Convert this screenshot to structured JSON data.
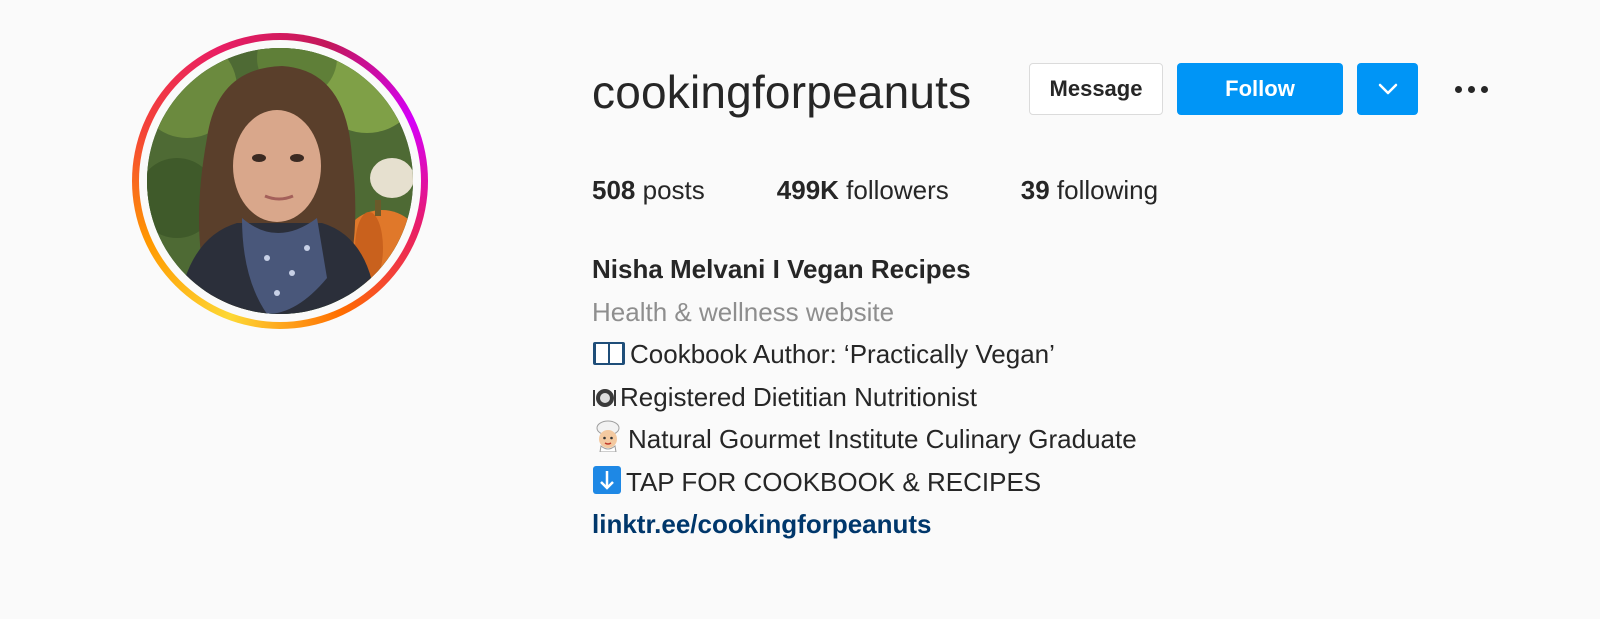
{
  "profile": {
    "username": "cookingforpeanuts",
    "avatar_alt": "profile picture"
  },
  "actions": {
    "message_label": "Message",
    "follow_label": "Follow",
    "dropdown_icon": "chevron-down-icon",
    "more_icon": "more-options-icon"
  },
  "stats": {
    "posts_count": "508",
    "posts_label": "posts",
    "followers_count": "499K",
    "followers_label": "followers",
    "following_count": "39",
    "following_label": "following"
  },
  "bio": {
    "name": "Nisha Melvani I Vegan Recipes",
    "category": "Health & wellness website",
    "lines": [
      {
        "icon": "open-book-icon",
        "text": "Cookbook Author: ‘Practically Vegan’"
      },
      {
        "icon": "plate-icon",
        "text": "Registered Dietitian Nutritionist"
      },
      {
        "icon": "chef-icon",
        "text": "Natural Gourmet Institute Culinary Graduate"
      },
      {
        "icon": "down-arrow-icon",
        "text": "TAP FOR COOKBOOK & RECIPES"
      }
    ],
    "link": "linktr.ee/cookingforpeanuts"
  },
  "colors": {
    "follow_blue": "#0095f6",
    "link_blue": "#00376b",
    "muted_gray": "#8e8e8e"
  }
}
